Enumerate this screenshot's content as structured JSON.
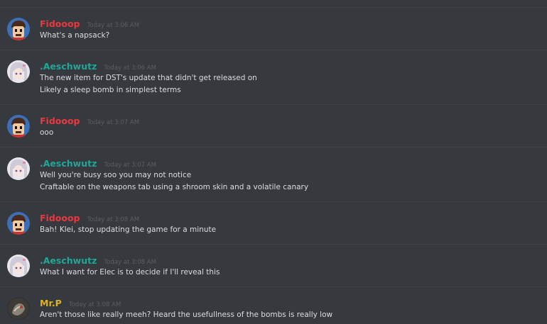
{
  "colors": {
    "background": "#36393e",
    "fidooop": "#e9383f",
    "aeschwutz": "#1fa797",
    "mrp": "#e0b21c"
  },
  "messages": [
    {
      "author": "Fidooop",
      "timestamp": "Today at 3:06 AM",
      "avatar": "fidooop-avatar-icon",
      "lines": [
        "What's a napsack?"
      ]
    },
    {
      "author": ".Aeschwutz",
      "timestamp": "Today at 3:06 AM",
      "avatar": "aeschwutz-avatar-icon",
      "lines": [
        "The new item for DST's update that didn't get released on",
        "Likely a sleep bomb in simplest terms"
      ]
    },
    {
      "author": "Fidooop",
      "timestamp": "Today at 3:07 AM",
      "avatar": "fidooop-avatar-icon",
      "lines": [
        "ooo"
      ]
    },
    {
      "author": ".Aeschwutz",
      "timestamp": "Today at 3:07 AM",
      "avatar": "aeschwutz-avatar-icon",
      "lines": [
        "Well you're busy soo you may not notice",
        "Craftable on the weapons tab using a shroom skin and a volatile canary"
      ]
    },
    {
      "author": "Fidooop",
      "timestamp": "Today at 3:08 AM",
      "avatar": "fidooop-avatar-icon",
      "lines": [
        "Bah! Klei, stop updating the game for a minute"
      ]
    },
    {
      "author": ".Aeschwutz",
      "timestamp": "Today at 3:08 AM",
      "avatar": "aeschwutz-avatar-icon",
      "lines": [
        "What I want for Elec is to decide if I'll reveal this"
      ]
    },
    {
      "author": "Mr.P",
      "timestamp": "Today at 3:08 AM",
      "avatar": "mrp-avatar-icon",
      "lines": [
        "Aren't those like really meeh? Heard the usefullness of the bombs is really low"
      ]
    }
  ]
}
